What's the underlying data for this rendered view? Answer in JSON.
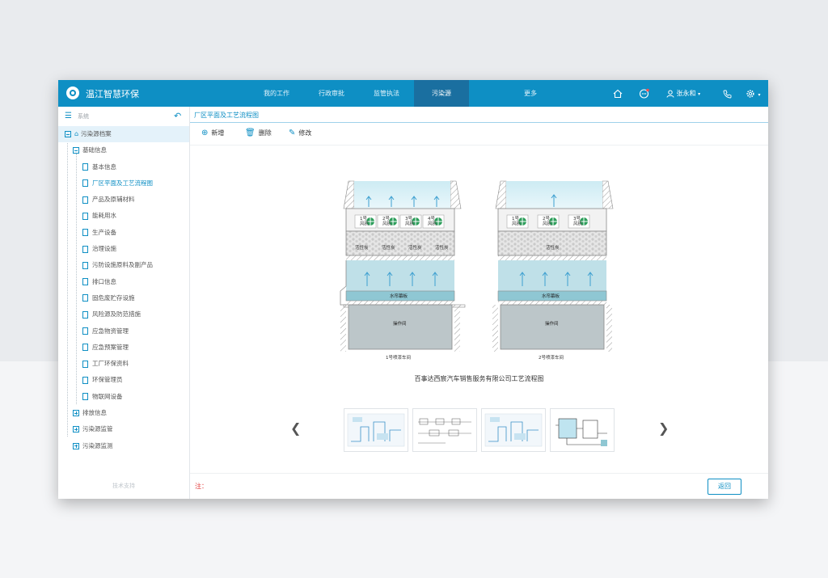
{
  "app": {
    "title": "温江智慧环保"
  },
  "nav": {
    "tabs": [
      "我的工作",
      "行政审批",
      "监管执法",
      "污染源"
    ],
    "active": "污染源",
    "more": "更多"
  },
  "header": {
    "user": "张永和"
  },
  "sidebar": {
    "title": "系统",
    "root": "污染源档案",
    "group": "基础信息",
    "items": [
      "基本信息",
      "厂区平面及工艺流程图",
      "产品及原辅材料",
      "能耗用水",
      "生产设备",
      "治理设施",
      "污防设施原料及副产品",
      "排口信息",
      "固危废贮存设施",
      "风险源及防范措施",
      "应急物资管理",
      "应急预案管理",
      "工厂环保资料",
      "环保管理员",
      "物联网设备"
    ],
    "selected": "厂区平面及工艺流程图",
    "others": [
      "排放信息",
      "污染源监管",
      "污染源监测"
    ],
    "footer": "技术支持"
  },
  "content": {
    "breadcrumb": "厂区平面及工艺流程图",
    "toolbar": {
      "add": "新增",
      "delete": "删除",
      "edit": "修改"
    },
    "diagram": {
      "booth1": {
        "fans": [
          "1号\n风机",
          "2号\n风机",
          "3号\n风机",
          "4号\n风机"
        ],
        "carbon": [
          "活性炭",
          "活性炭",
          "活性炭",
          "活性炭"
        ],
        "curtain": "水帘幕板",
        "room": "操作间",
        "label": "1号喷漆车间"
      },
      "booth2": {
        "fans": [
          "1号\n风机",
          "2号\n风机",
          "3号\n风机"
        ],
        "carbon": "活性炭",
        "curtain": "水帘幕板",
        "room": "操作间",
        "label": "2号喷漆车间"
      }
    },
    "caption": "百事达西宸汽车销售服务有限公司工艺流程图",
    "note": "注：",
    "return": "返回"
  },
  "colors": {
    "primary": "#0e8fc4",
    "nav_active": "#1a6fa0",
    "note_red": "#e23b3b"
  },
  "icons": [
    "home-icon",
    "chat-icon",
    "user-icon",
    "phone-icon",
    "settings-icon",
    "menu-icon",
    "back-icon",
    "add-icon",
    "delete-icon",
    "edit-icon"
  ]
}
